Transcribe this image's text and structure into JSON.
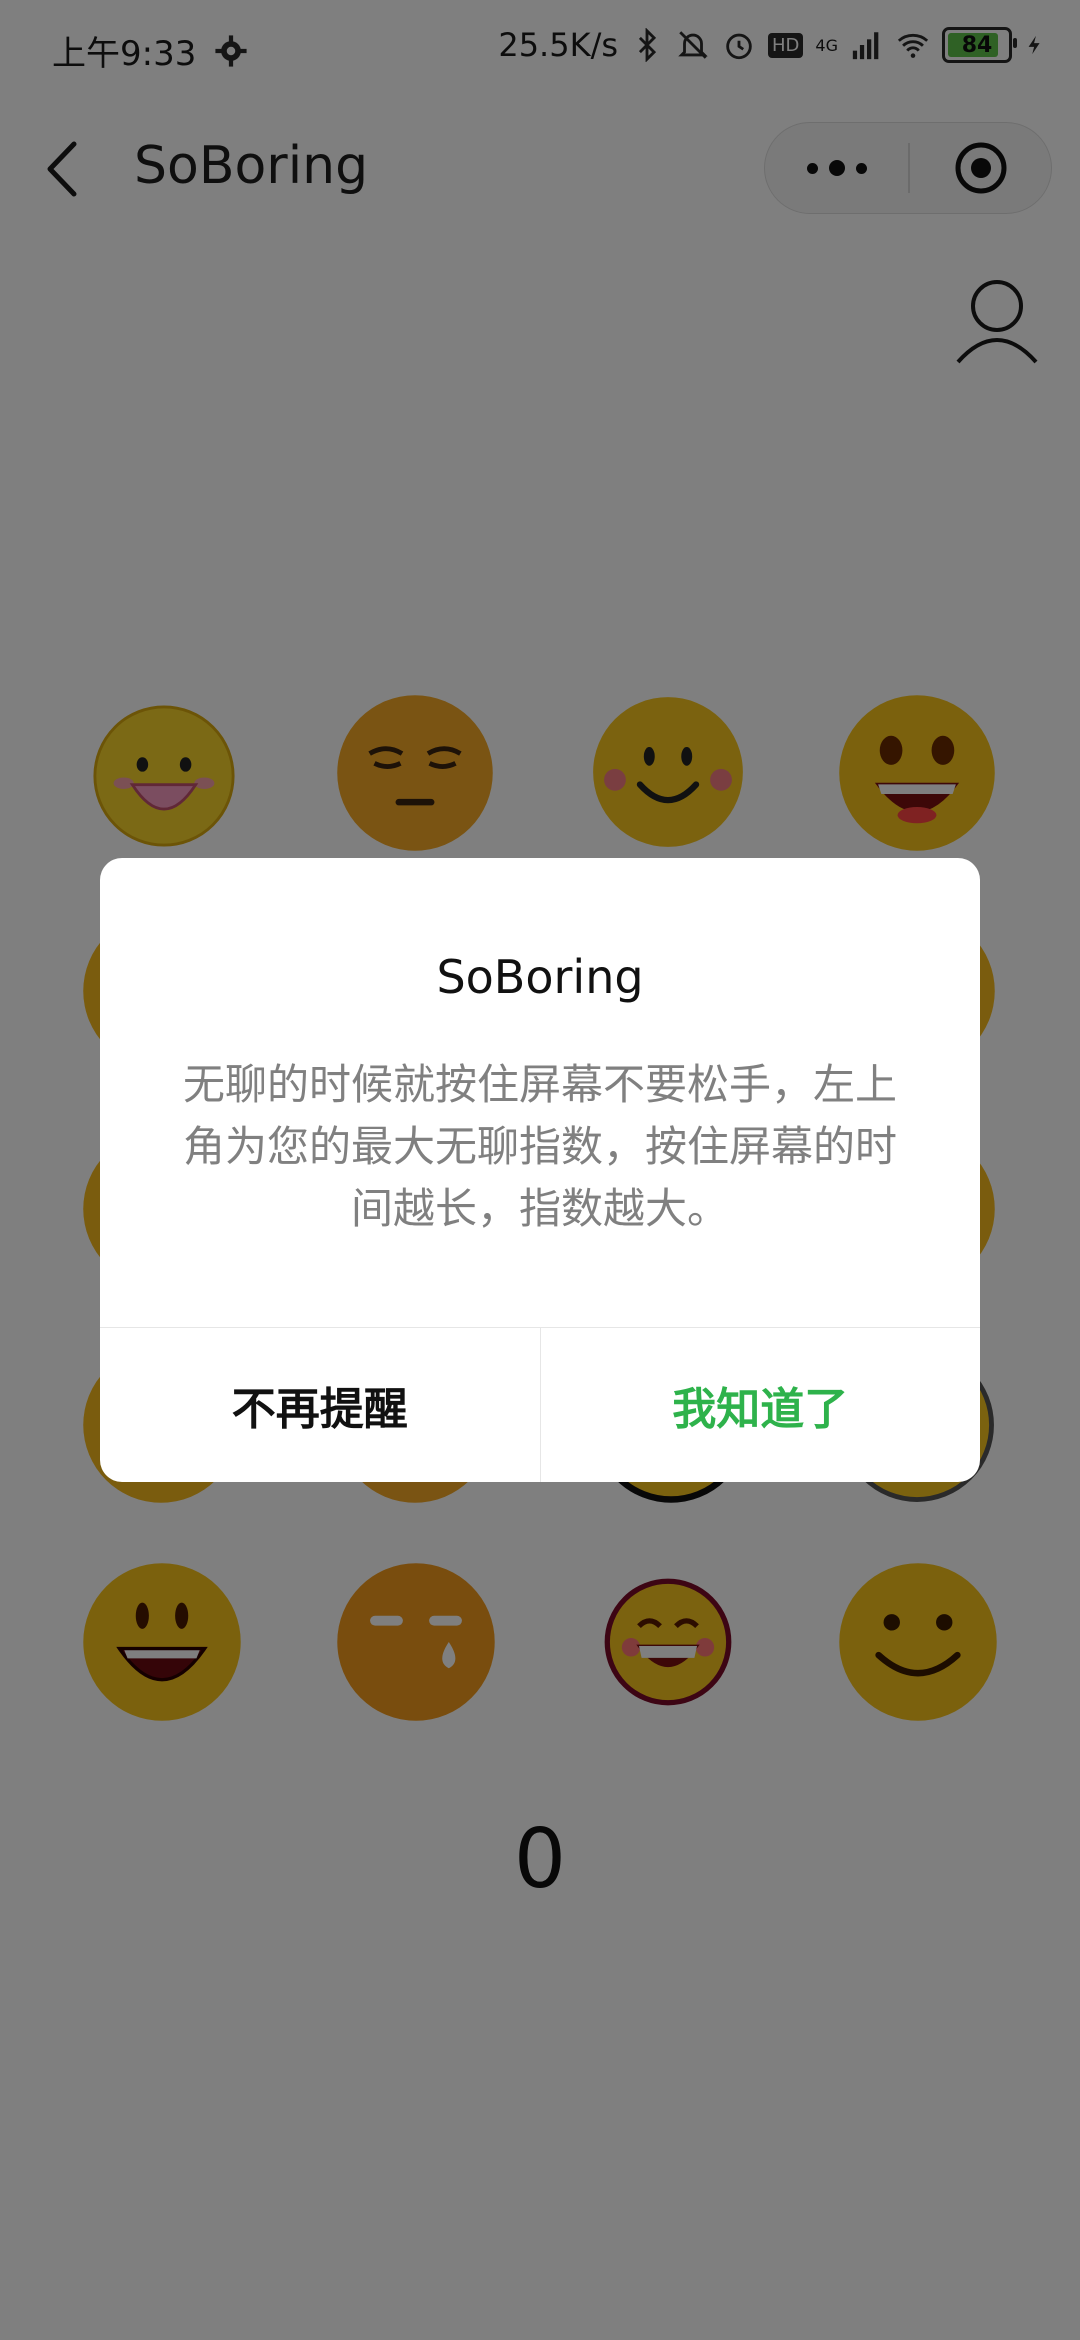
{
  "status_bar": {
    "time": "上午9:33",
    "network_speed": "25.5K/s",
    "network_type": "4G",
    "hd_badge": "HD",
    "battery_level": "84",
    "icons": [
      "gear-icon",
      "bluetooth-icon",
      "bell-muted-icon",
      "alarm-icon",
      "hd-icon",
      "signal-icon",
      "wifi-icon",
      "battery-icon",
      "charging-icon"
    ]
  },
  "nav": {
    "title": "SoBoring",
    "back_icon": "chevron-left-icon",
    "more_icon": "more-dots-icon",
    "close_icon": "target-close-icon"
  },
  "profile_icon": "user-icon",
  "counter": {
    "value": "0"
  },
  "emoji_grid": {
    "rows": 5,
    "columns": 4,
    "visible_faces": [
      "laughing",
      "meh",
      "smile",
      "big-grin",
      "laughing",
      "sweat-tear",
      "grin-blush",
      "smile"
    ]
  },
  "dialog": {
    "title": "SoBoring",
    "body": "无聊的时候就按住屏幕不要松手，左上角为您的最大无聊指数，按住屏幕的时间越长，指数越大。",
    "cancel_label": "不再提醒",
    "confirm_label": "我知道了",
    "confirm_color": "#2eb24b"
  },
  "colors": {
    "emoji_yellow": "#f5c518",
    "emoji_orange": "#f4a31c",
    "mask": "rgba(0,0,0,0.5)"
  }
}
